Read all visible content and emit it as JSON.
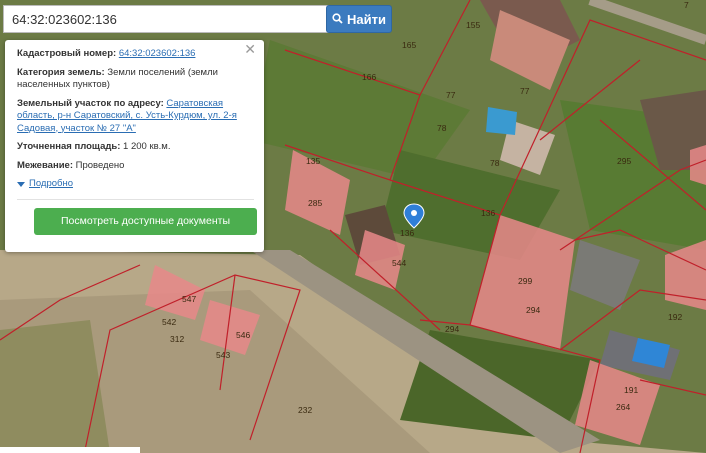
{
  "search": {
    "value": "64:32:023602:136",
    "button_label": "Найти"
  },
  "popup": {
    "cadastral_label": "Кадастровый номер:",
    "cadastral_value": "64:32:023602:136",
    "category_label": "Категория земель:",
    "category_value": "Земли поселений (земли населенных пунктов)",
    "address_label": "Земельный участок по адресу:",
    "address_value": "Саратовская область, р-н Саратовский, с. Усть-Курдюм, ул. 2-я Садовая, участок № 27 \"А\"",
    "area_label": "Уточненная площадь:",
    "area_value": "1 200 кв.м.",
    "survey_label": "Межевание:",
    "survey_value": "Проведено",
    "more_label": "Подробно",
    "docs_button": "Посмотреть доступные документы"
  },
  "map": {
    "parcel_labels": [
      "165",
      "166",
      "77",
      "77",
      "78",
      "78",
      "135",
      "285",
      "136",
      "136",
      "544",
      "295",
      "299",
      "294",
      "294",
      "547",
      "542",
      "312",
      "546",
      "543",
      "232",
      "191",
      "264",
      "192",
      "155",
      "7"
    ]
  },
  "colors": {
    "accent": "#3b7bbf",
    "button_green": "#4cae4f",
    "parcel_fill": "#e8888a",
    "parcel_line": "#c0202a",
    "marker": "#2f7fd8"
  }
}
